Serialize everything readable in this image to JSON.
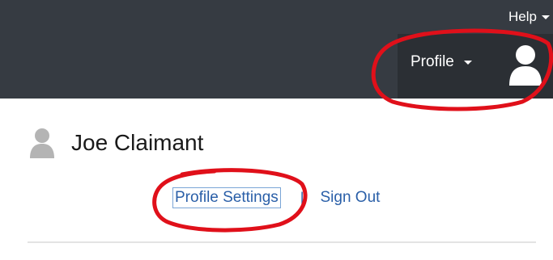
{
  "header": {
    "help_label": "Help",
    "profile_label": "Profile"
  },
  "user": {
    "name": "Joe Claimant"
  },
  "links": {
    "profile_settings": "Profile Settings",
    "separator": "|",
    "sign_out": "Sign Out"
  },
  "colors": {
    "header_bg": "#363b42",
    "profile_bg": "#2b2f34",
    "link": "#2a5fa8",
    "annotation": "#e0101a"
  }
}
